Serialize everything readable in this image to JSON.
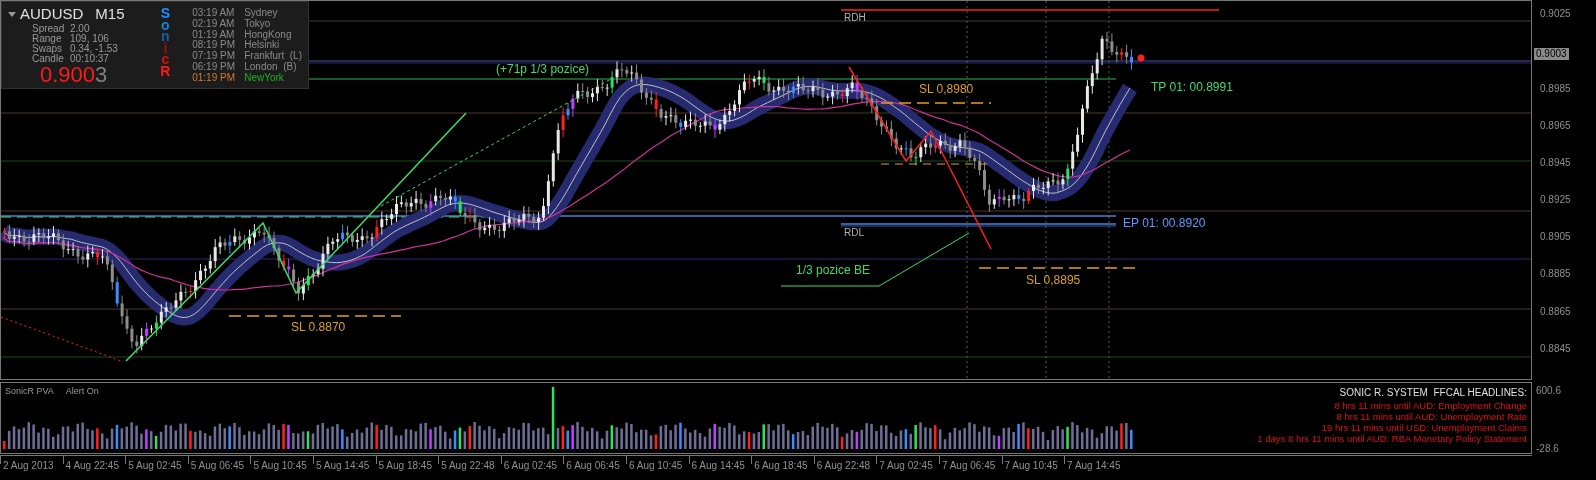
{
  "info_panel": {
    "symbol": "AUDUSD",
    "timeframe": "M15",
    "stats": [
      {
        "label": "Spread",
        "value": "2.00"
      },
      {
        "label": "Range",
        "value": "109, 106"
      },
      {
        "label": "Swaps",
        "value": "0.34, -1.53"
      },
      {
        "label": "Candle",
        "value": "00:10:37"
      }
    ],
    "price_main": "0.900",
    "price_pip": "3",
    "logo_letters": [
      {
        "text": "S",
        "color": "#1e90ff"
      },
      {
        "text": "o",
        "color": "#1e7fd0"
      },
      {
        "text": "n",
        "color": "#1a5fa0"
      },
      {
        "text": "i",
        "color": "#a01010"
      },
      {
        "text": "c",
        "color": "#d01010"
      },
      {
        "text": "R",
        "color": "#ff1a1a"
      }
    ],
    "clocks": [
      {
        "time": "03:19 AM",
        "city": "Sydney",
        "selected": false
      },
      {
        "time": "02:19 AM",
        "city": "Tokyo",
        "selected": false
      },
      {
        "time": "01:19 AM",
        "city": "HongKong",
        "selected": false
      },
      {
        "time": "08:19 PM",
        "city": "Helsinki",
        "selected": false
      },
      {
        "time": "07:19 PM",
        "city": "Frankfurt  (L)",
        "selected": false
      },
      {
        "time": "06:19 PM",
        "city": "London  (B)",
        "selected": false
      },
      {
        "time": "01:19 PM",
        "city": "NewYork",
        "selected": true
      }
    ]
  },
  "chart_labels": [
    {
      "text": "(+71p 1/3 pozice)",
      "color": "#3ddc6a"
    },
    {
      "text": "SL 0.8870",
      "color": "#e0a020"
    },
    {
      "text": "SL 0,8980",
      "color": "#e0a020"
    },
    {
      "text": "SL 0,8895",
      "color": "#e0a020"
    },
    {
      "text": "1/3 pozice BE",
      "color": "#3ddc6a"
    },
    {
      "text": "TP 01: 00.8991",
      "color": "#3ddc6a"
    },
    {
      "text": "EP 01: 00.8920",
      "color": "#5b9bff"
    },
    {
      "text": "RDH",
      "color": "#b0b0b0"
    },
    {
      "text": "RDL",
      "color": "#b0b0b0"
    }
  ],
  "price_axis": {
    "labels": [
      "0.9025",
      "0.8985",
      "0.8965",
      "0.8945",
      "0.8925",
      "0.8905",
      "0.8885",
      "0.8865",
      "0.8845"
    ],
    "current": "0.9003"
  },
  "indicator": {
    "name": "SonicR PVA",
    "status": "Alert On",
    "max": "600.6",
    "min": "-28.6"
  },
  "headlines": {
    "title": "SONIC R. SYSTEM  FFCAL HEADLINES:",
    "items": [
      "8 hrs 11 mins until AUD: Employment Change",
      "8 hrs 11 mins until AUD: Unemployment Rate",
      "19 hrs 11 mins until USD: Unemployment Claims",
      "1 days 8 hrs 11 mins until AUD: RBA Monetary Policy Statement"
    ]
  },
  "time_axis": [
    "2 Aug 2013",
    "4 Aug 22:45",
    "5 Aug 02:45",
    "5 Aug 06:45",
    "5 Aug 10:45",
    "5 Aug 14:45",
    "5 Aug 18:45",
    "5 Aug 22:48",
    "6 Aug 02:45",
    "6 Aug 06:45",
    "6 Aug 10:45",
    "6 Aug 14:45",
    "6 Aug 18:45",
    "6 Aug 22:48",
    "7 Aug 02:45",
    "7 Aug 06:45",
    "7 Aug 10:45",
    "7 Aug 14:45"
  ]
}
